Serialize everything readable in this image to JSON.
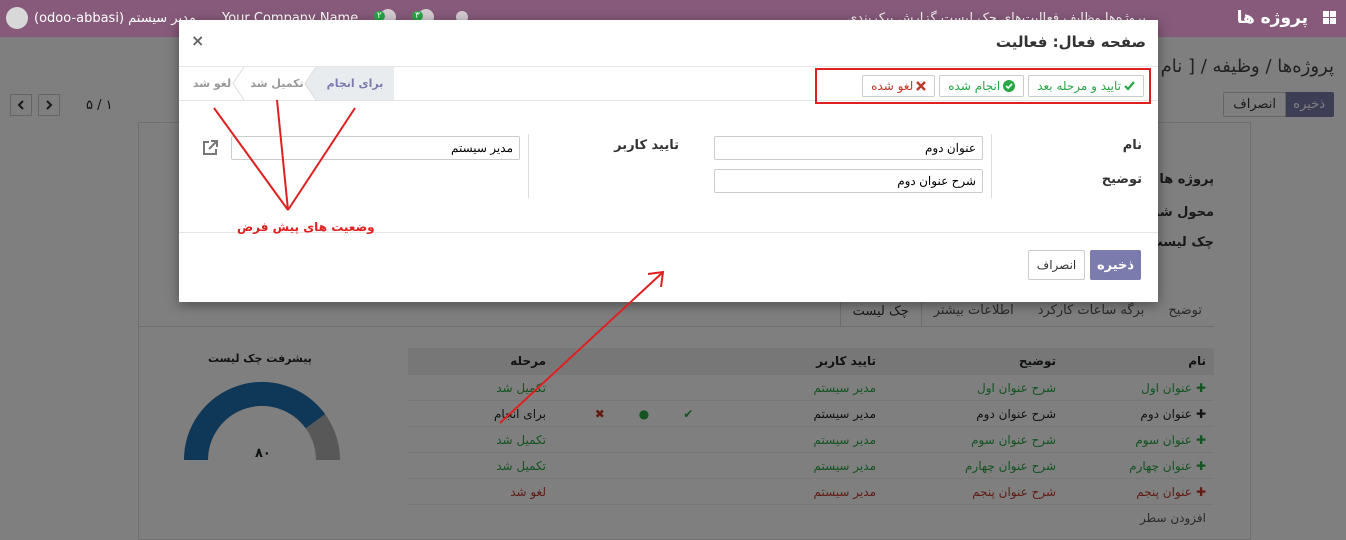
{
  "navbar": {
    "brand": "پروژه ها",
    "menu_text": "پروژه‌ها   وظایف   فعالیت‌های چک لیست   گزارش   پیکربندی",
    "user": "مدیر سیستم (odoo-abbasi)",
    "company": "Your Company Name",
    "badge_messages": "۳",
    "badge_activities": "۲"
  },
  "control_panel": {
    "breadcrumb": "پروژه‌ها / وظیفه / [ نام و",
    "save_label": "ذخیره",
    "discard_label": "انصراف",
    "pager_value": "۱ / ۵"
  },
  "background_form": {
    "labels": [
      "پروژه ها",
      "محول شد",
      "چک لیست"
    ],
    "tabs": [
      "توضیح",
      "برگه ساعات کارکرد",
      "اطلاعات بیشتر",
      "چک لیست"
    ],
    "active_tab": "چک لیست",
    "gauge_title": "پیشرفت چک لیست",
    "gauge_value": "۸۰",
    "gauge_fraction": 0.8,
    "table_headers": [
      "نام",
      "توضیح",
      "تایید کاربر",
      "مرحله"
    ],
    "rows": [
      {
        "name": "عنوان اول",
        "desc": "شرح عنوان اول",
        "user": "مدیر سیستم",
        "stage": "تکمیل شد",
        "status": "done"
      },
      {
        "name": "عنوان دوم",
        "desc": "شرح عنوان دوم",
        "user": "مدیر سیستم",
        "stage": "برای انجام",
        "status": "todo"
      },
      {
        "name": "عنوان سوم",
        "desc": "شرح عنوان سوم",
        "user": "مدیر سیستم",
        "stage": "تکمیل شد",
        "status": "done"
      },
      {
        "name": "عنوان چهارم",
        "desc": "شرح عنوان چهارم",
        "user": "مدیر سیستم",
        "stage": "تکمیل شد",
        "status": "done"
      },
      {
        "name": "عنوان پنجم",
        "desc": "شرح عنوان پنجم",
        "user": "مدیر سیستم",
        "stage": "لغو شد",
        "status": "cancel"
      }
    ],
    "add_line": "افزودن سطر"
  },
  "modal": {
    "title": "صفحه فعال: فعالیت",
    "close_icon": "close-icon",
    "status_buttons": {
      "confirm": "تایید و مرحله بعد",
      "done": "انجام شده",
      "cancel": "لغو شده"
    },
    "stages": {
      "current": "برای انجام",
      "completed": "تکمیل شد",
      "cancelled": "لغو شد"
    },
    "fields": {
      "name_label": "نام",
      "name_value": "عنوان دوم",
      "description_label": "توضیح",
      "description_value": "شرح عنوان دوم",
      "user_label": "تایید کاربر",
      "user_value": "مدیر سیستم"
    },
    "save_label": "ذخیره",
    "discard_label": "انصراف"
  },
  "annotation": {
    "text": "وضعیت های پیش فرض",
    "color": "#e02020"
  },
  "colors": {
    "navbar": "#875a7b",
    "primary": "#7c7bad",
    "success": "#28a745",
    "danger": "#c0392b"
  }
}
